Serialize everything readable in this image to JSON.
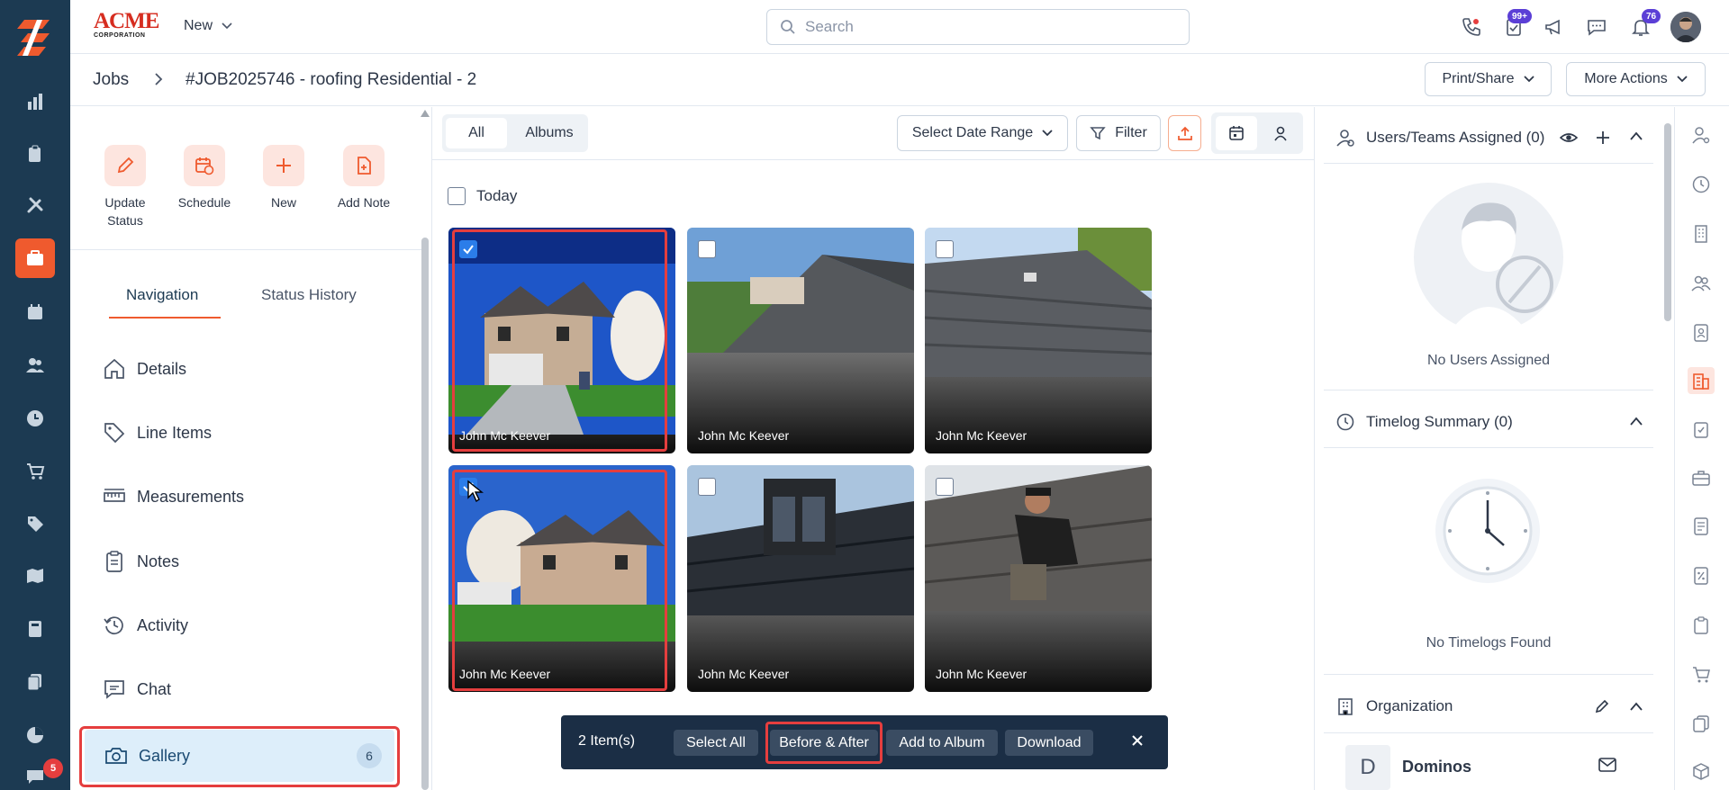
{
  "brand": {
    "name_top": "ACME",
    "name_bottom": "CORPORATION"
  },
  "topbar": {
    "new_label": "New",
    "search_placeholder": "Search",
    "tasks_badge": "99+",
    "notifications_badge": "76"
  },
  "breadcrumb": {
    "root": "Jobs",
    "title": "#JOB2025746 - roofing Residential - 2"
  },
  "header_actions": {
    "print_share": "Print/Share",
    "more_actions": "More Actions"
  },
  "quick_actions": [
    {
      "label": "Update Status",
      "icon": "pencil-icon"
    },
    {
      "label": "Schedule",
      "icon": "calendar-clock-icon"
    },
    {
      "label": "New",
      "icon": "plus-icon"
    },
    {
      "label": "Add Note",
      "icon": "file-plus-icon"
    }
  ],
  "nav_tabs": {
    "navigation": "Navigation",
    "status_history": "Status History"
  },
  "nav_items": [
    {
      "label": "Details",
      "icon": "home-icon"
    },
    {
      "label": "Line Items",
      "icon": "tag-icon"
    },
    {
      "label": "Measurements",
      "icon": "ruler-icon"
    },
    {
      "label": "Notes",
      "icon": "clipboard-icon"
    },
    {
      "label": "Activity",
      "icon": "history-icon"
    },
    {
      "label": "Chat",
      "icon": "chat-icon"
    }
  ],
  "gallery_nav": {
    "label": "Gallery",
    "count": "6",
    "icon": "camera-settings-icon"
  },
  "rail": {
    "badge": "5"
  },
  "gallery": {
    "tabs": {
      "all": "All",
      "albums": "Albums"
    },
    "date_range": "Select Date Range",
    "filter": "Filter",
    "group_label": "Today",
    "photos": [
      {
        "author": "John Mc Keever",
        "selected": true
      },
      {
        "author": "John Mc Keever",
        "selected": false
      },
      {
        "author": "John Mc Keever",
        "selected": false
      },
      {
        "author": "John Mc Keever",
        "selected": true
      },
      {
        "author": "John Mc Keever",
        "selected": false
      },
      {
        "author": "John Mc Keever",
        "selected": false
      }
    ]
  },
  "action_bar": {
    "count": "2 Item(s)",
    "select_all": "Select All",
    "before_after": "Before & After",
    "add_to_album": "Add to Album",
    "download": "Download"
  },
  "right_panel": {
    "users_title": "Users/Teams Assigned (0)",
    "no_users": "No Users Assigned",
    "timelog_title": "Timelog Summary (0)",
    "no_timelogs": "No Timelogs Found",
    "org_title": "Organization",
    "org_initial": "D",
    "org_name": "Dominos"
  },
  "colors": {
    "accent": "#ef5a2e",
    "rail": "#1c3a52",
    "highlight": "#e53e3e",
    "selection": "#2b7de9"
  }
}
